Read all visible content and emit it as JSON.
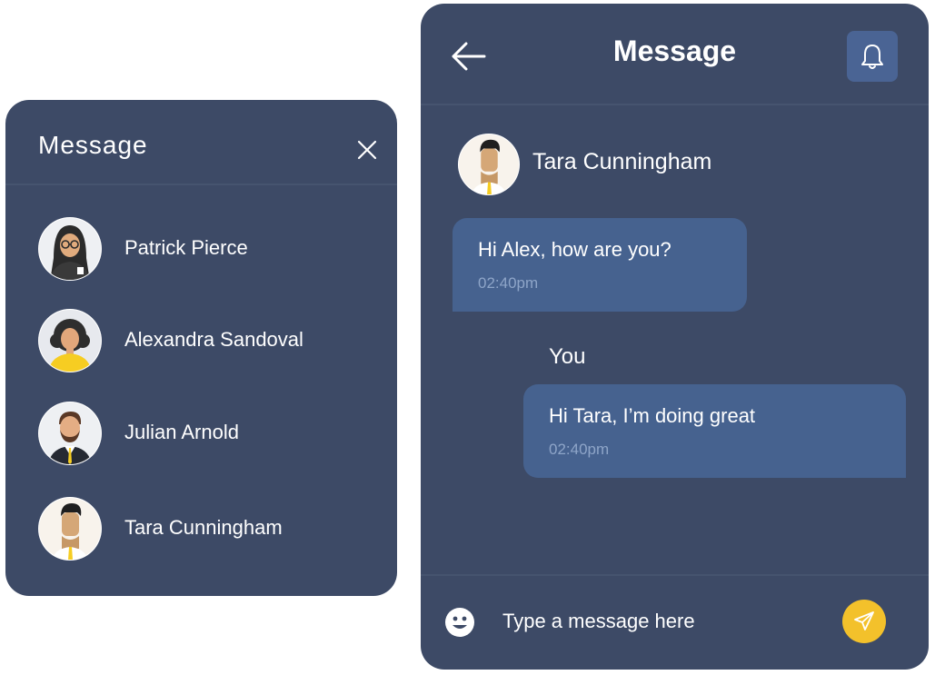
{
  "contacts_panel": {
    "title": "Message",
    "close_icon": "close-icon",
    "contacts": [
      {
        "name": "Patrick Pierce",
        "avatar": "avatar-woman-hijab-glasses"
      },
      {
        "name": "Alexandra Sandoval",
        "avatar": "avatar-woman-curly-hair"
      },
      {
        "name": "Julian Arnold",
        "avatar": "avatar-man-beard-suit"
      },
      {
        "name": "Tara Cunningham",
        "avatar": "avatar-man-dark-hair"
      }
    ]
  },
  "chat": {
    "title": "Message",
    "back_icon": "arrow-left-icon",
    "bell_icon": "bell-icon",
    "contact": {
      "name": "Tara Cunningham",
      "avatar": "avatar-man-dark-hair"
    },
    "messages": [
      {
        "direction": "incoming",
        "text": "Hi Alex, how are you?",
        "time": "02:40pm"
      },
      {
        "direction": "outgoing",
        "sender": "You",
        "text": "Hi Tara, I’m doing great",
        "time": "02:40pm"
      }
    ],
    "input": {
      "placeholder": "Type a message here",
      "value": ""
    },
    "emoji_icon": "emoji-smile-icon",
    "send_icon": "send-icon"
  },
  "colors": {
    "panel_bg": "#3d4a66",
    "bubble_bg": "#46628f",
    "divider": "#46546f",
    "bell_button_bg": "#4a6494",
    "send_button_bg": "#f3c12b",
    "timestamp": "#8ea5c8",
    "text": "#ffffff"
  }
}
